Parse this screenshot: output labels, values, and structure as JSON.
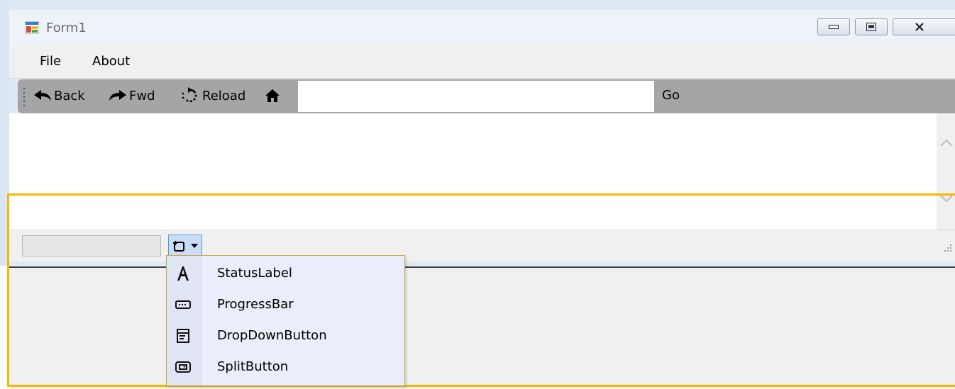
{
  "window": {
    "title": "Form1"
  },
  "menu": {
    "items": [
      {
        "label": "File"
      },
      {
        "label": "About"
      }
    ]
  },
  "toolbar": {
    "back_label": "Back",
    "fwd_label": "Fwd",
    "reload_label": "Reload",
    "url_value": "",
    "go_label": "Go"
  },
  "status_strip": {
    "add_item_icon": "add-statusstrip-item-icon"
  },
  "dropdown": {
    "items": [
      {
        "label": "StatusLabel",
        "icon": "status-label-icon"
      },
      {
        "label": "ProgressBar",
        "icon": "progress-bar-icon"
      },
      {
        "label": "DropDownButton",
        "icon": "dropdown-button-icon"
      },
      {
        "label": "SplitButton",
        "icon": "split-button-icon"
      }
    ]
  },
  "colors": {
    "selection": "#f4b800",
    "toolbar": "#a5a5a5",
    "dropdown_bg": "#e9eefa"
  }
}
